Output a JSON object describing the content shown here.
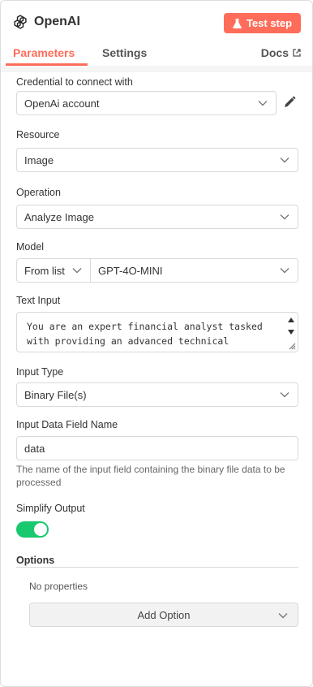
{
  "node": {
    "title": "OpenAI",
    "test_step_label": "Test step"
  },
  "tabs": {
    "parameters": "Parameters",
    "settings": "Settings",
    "docs": "Docs"
  },
  "fields": {
    "credential": {
      "label": "Credential to connect with",
      "value": "OpenAi account"
    },
    "resource": {
      "label": "Resource",
      "value": "Image"
    },
    "operation": {
      "label": "Operation",
      "value": "Analyze Image"
    },
    "model": {
      "label": "Model",
      "mode": "From list",
      "value": "GPT-4O-MINI"
    },
    "text_input": {
      "label": "Text Input",
      "value": "You are an expert financial analyst tasked\nwith providing an advanced technical analyses"
    },
    "input_type": {
      "label": "Input Type",
      "value": "Binary File(s)"
    },
    "input_data_field": {
      "label": "Input Data Field Name",
      "value": "data",
      "hint": "The name of the input field containing the binary file data to be processed"
    },
    "simplify_output": {
      "label": "Simplify Output",
      "enabled": true
    }
  },
  "options": {
    "title": "Options",
    "empty_text": "No properties",
    "add_label": "Add Option"
  },
  "colors": {
    "accent": "#ff6d5a",
    "toggle_on": "#18c96f"
  }
}
